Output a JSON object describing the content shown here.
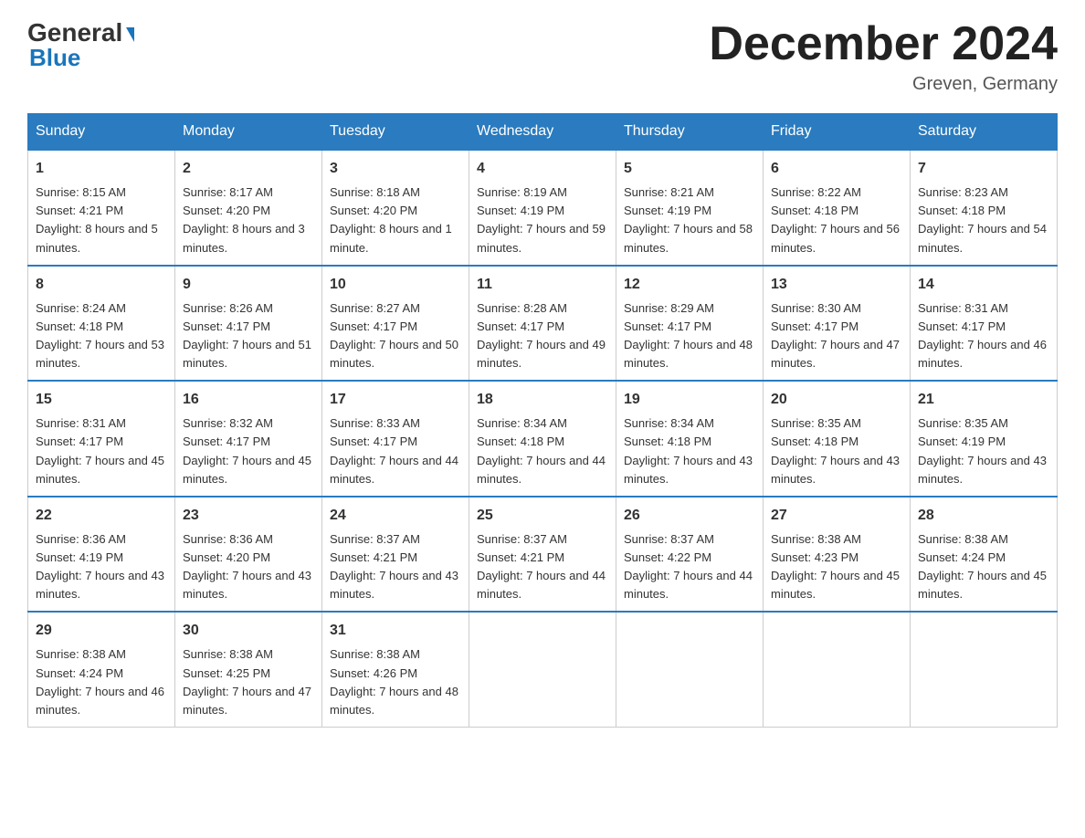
{
  "logo": {
    "general": "General",
    "arrow": "▼",
    "blue": "Blue"
  },
  "title": "December 2024",
  "location": "Greven, Germany",
  "days_of_week": [
    "Sunday",
    "Monday",
    "Tuesday",
    "Wednesday",
    "Thursday",
    "Friday",
    "Saturday"
  ],
  "weeks": [
    [
      {
        "day": "1",
        "sunrise": "8:15 AM",
        "sunset": "4:21 PM",
        "daylight": "8 hours and 5 minutes."
      },
      {
        "day": "2",
        "sunrise": "8:17 AM",
        "sunset": "4:20 PM",
        "daylight": "8 hours and 3 minutes."
      },
      {
        "day": "3",
        "sunrise": "8:18 AM",
        "sunset": "4:20 PM",
        "daylight": "8 hours and 1 minute."
      },
      {
        "day": "4",
        "sunrise": "8:19 AM",
        "sunset": "4:19 PM",
        "daylight": "7 hours and 59 minutes."
      },
      {
        "day": "5",
        "sunrise": "8:21 AM",
        "sunset": "4:19 PM",
        "daylight": "7 hours and 58 minutes."
      },
      {
        "day": "6",
        "sunrise": "8:22 AM",
        "sunset": "4:18 PM",
        "daylight": "7 hours and 56 minutes."
      },
      {
        "day": "7",
        "sunrise": "8:23 AM",
        "sunset": "4:18 PM",
        "daylight": "7 hours and 54 minutes."
      }
    ],
    [
      {
        "day": "8",
        "sunrise": "8:24 AM",
        "sunset": "4:18 PM",
        "daylight": "7 hours and 53 minutes."
      },
      {
        "day": "9",
        "sunrise": "8:26 AM",
        "sunset": "4:17 PM",
        "daylight": "7 hours and 51 minutes."
      },
      {
        "day": "10",
        "sunrise": "8:27 AM",
        "sunset": "4:17 PM",
        "daylight": "7 hours and 50 minutes."
      },
      {
        "day": "11",
        "sunrise": "8:28 AM",
        "sunset": "4:17 PM",
        "daylight": "7 hours and 49 minutes."
      },
      {
        "day": "12",
        "sunrise": "8:29 AM",
        "sunset": "4:17 PM",
        "daylight": "7 hours and 48 minutes."
      },
      {
        "day": "13",
        "sunrise": "8:30 AM",
        "sunset": "4:17 PM",
        "daylight": "7 hours and 47 minutes."
      },
      {
        "day": "14",
        "sunrise": "8:31 AM",
        "sunset": "4:17 PM",
        "daylight": "7 hours and 46 minutes."
      }
    ],
    [
      {
        "day": "15",
        "sunrise": "8:31 AM",
        "sunset": "4:17 PM",
        "daylight": "7 hours and 45 minutes."
      },
      {
        "day": "16",
        "sunrise": "8:32 AM",
        "sunset": "4:17 PM",
        "daylight": "7 hours and 45 minutes."
      },
      {
        "day": "17",
        "sunrise": "8:33 AM",
        "sunset": "4:17 PM",
        "daylight": "7 hours and 44 minutes."
      },
      {
        "day": "18",
        "sunrise": "8:34 AM",
        "sunset": "4:18 PM",
        "daylight": "7 hours and 44 minutes."
      },
      {
        "day": "19",
        "sunrise": "8:34 AM",
        "sunset": "4:18 PM",
        "daylight": "7 hours and 43 minutes."
      },
      {
        "day": "20",
        "sunrise": "8:35 AM",
        "sunset": "4:18 PM",
        "daylight": "7 hours and 43 minutes."
      },
      {
        "day": "21",
        "sunrise": "8:35 AM",
        "sunset": "4:19 PM",
        "daylight": "7 hours and 43 minutes."
      }
    ],
    [
      {
        "day": "22",
        "sunrise": "8:36 AM",
        "sunset": "4:19 PM",
        "daylight": "7 hours and 43 minutes."
      },
      {
        "day": "23",
        "sunrise": "8:36 AM",
        "sunset": "4:20 PM",
        "daylight": "7 hours and 43 minutes."
      },
      {
        "day": "24",
        "sunrise": "8:37 AM",
        "sunset": "4:21 PM",
        "daylight": "7 hours and 43 minutes."
      },
      {
        "day": "25",
        "sunrise": "8:37 AM",
        "sunset": "4:21 PM",
        "daylight": "7 hours and 44 minutes."
      },
      {
        "day": "26",
        "sunrise": "8:37 AM",
        "sunset": "4:22 PM",
        "daylight": "7 hours and 44 minutes."
      },
      {
        "day": "27",
        "sunrise": "8:38 AM",
        "sunset": "4:23 PM",
        "daylight": "7 hours and 45 minutes."
      },
      {
        "day": "28",
        "sunrise": "8:38 AM",
        "sunset": "4:24 PM",
        "daylight": "7 hours and 45 minutes."
      }
    ],
    [
      {
        "day": "29",
        "sunrise": "8:38 AM",
        "sunset": "4:24 PM",
        "daylight": "7 hours and 46 minutes."
      },
      {
        "day": "30",
        "sunrise": "8:38 AM",
        "sunset": "4:25 PM",
        "daylight": "7 hours and 47 minutes."
      },
      {
        "day": "31",
        "sunrise": "8:38 AM",
        "sunset": "4:26 PM",
        "daylight": "7 hours and 48 minutes."
      },
      null,
      null,
      null,
      null
    ]
  ]
}
